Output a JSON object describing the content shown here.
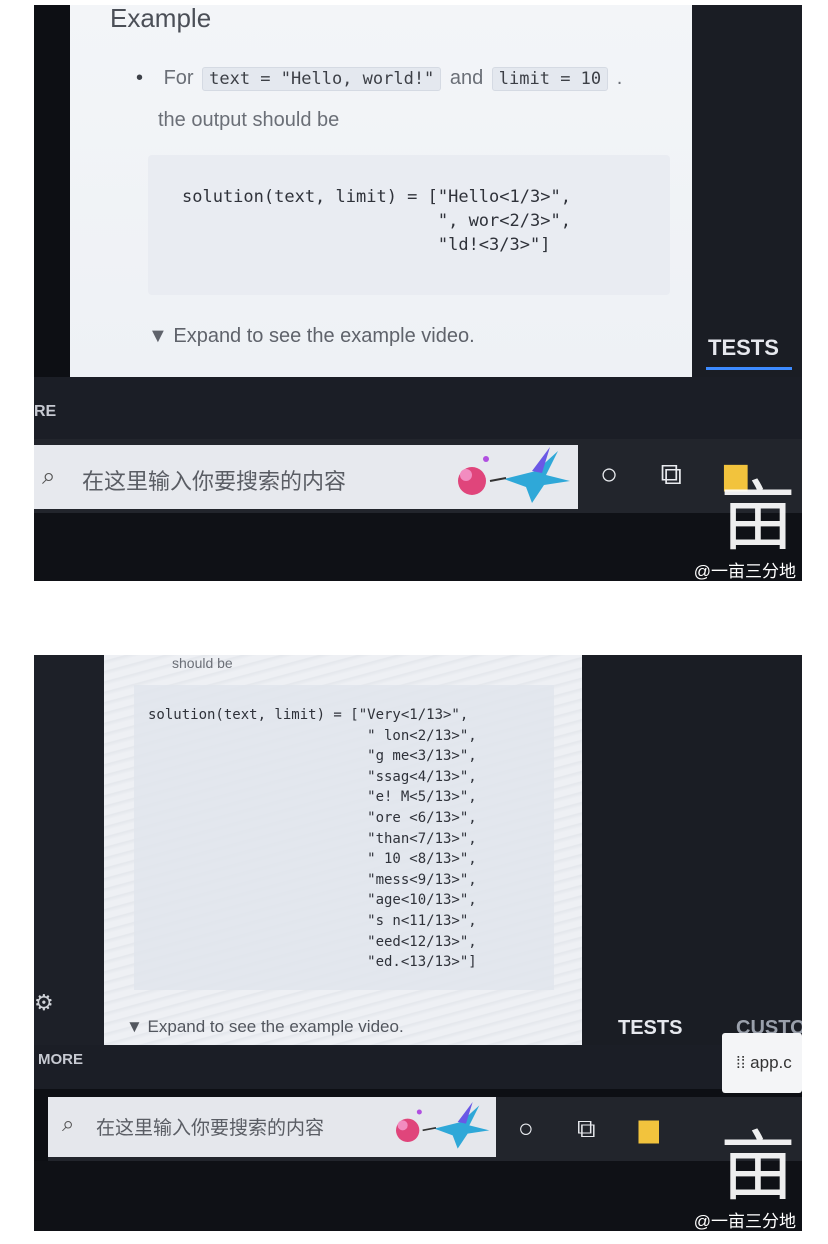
{
  "top_photo": {
    "heading": "Example",
    "bullet": {
      "for": "For",
      "text_chip": "text = \"Hello, world!\"",
      "and": "and",
      "limit_chip": "limit = 10",
      "period": ".",
      "continuation": "the output should be"
    },
    "code": "solution(text, limit) = [\"Hello<1/3>\",\n                         \", wor<2/3>\",\n                         \"ld!<3/3>\"]",
    "expand": "▼ Expand to see the example video.",
    "tab_tests": "TESTS",
    "more_fragment": "RE",
    "search_placeholder": "在这里输入你要搜索的内容",
    "search_icon": "search-icon"
  },
  "bottom_photo": {
    "should_be": "should be",
    "code": "solution(text, limit) = [\"Very<1/13>\",\n                          \" lon<2/13>\",\n                          \"g me<3/13>\",\n                          \"ssag<4/13>\",\n                          \"e! M<5/13>\",\n                          \"ore <6/13>\",\n                          \"than<7/13>\",\n                          \" 10 <8/13>\",\n                          \"mess<9/13>\",\n                          \"age<10/13>\",\n                          \"s n<11/13>\",\n                          \"eed<12/13>\",\n                          \"ed.<13/13>\"]",
    "expand": "▼ Expand to see the example video.",
    "tab_tests": "TESTS",
    "tab_custom_fragment": "CUSTO",
    "more": "MORE",
    "tooltip": "⁞⁞  app.c",
    "search_placeholder": "在这里输入你要搜索的内容"
  },
  "watermark": {
    "glyph": "亩",
    "handle": "@一亩三分地"
  },
  "colors": {
    "accent_tab": "#3d8bff",
    "screen_bg": "#eef1f5",
    "taskbar": "#22252c"
  }
}
